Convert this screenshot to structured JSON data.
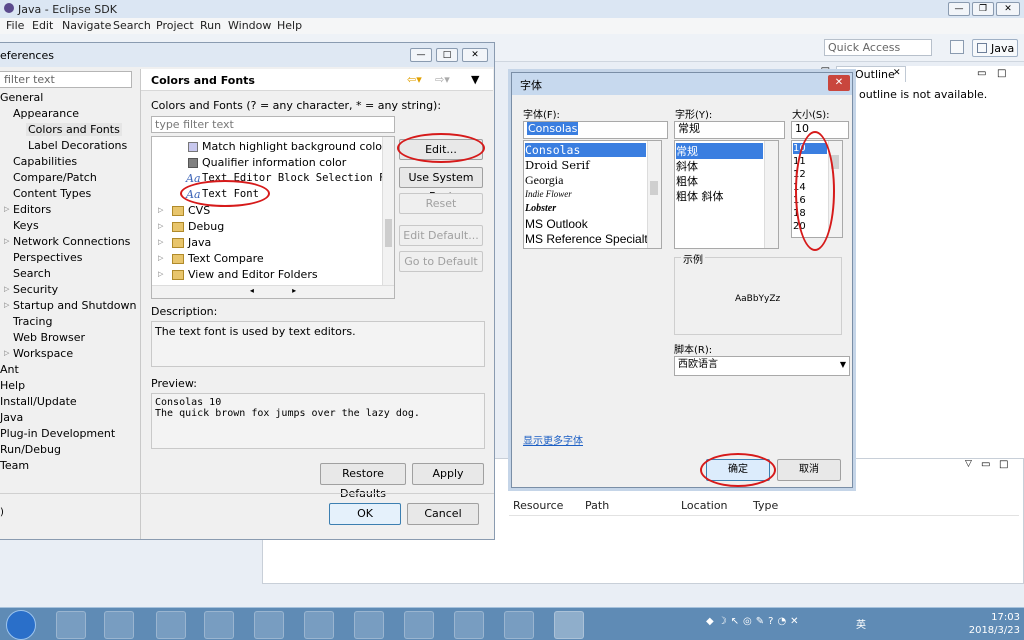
{
  "window": {
    "title": "Java - Eclipse SDK"
  },
  "menu": [
    "File",
    "Edit",
    "Navigate",
    "Search",
    "Project",
    "Run",
    "Window",
    "Help"
  ],
  "toolbar": {
    "quick_access": "Quick Access",
    "perspective": "Java"
  },
  "outline": {
    "tab": "Outline",
    "message": "outline is not available."
  },
  "problems_table": {
    "columns": [
      "Resource",
      "Path",
      "Location",
      "Type"
    ]
  },
  "prefs": {
    "title": "eferences",
    "filter_placeholder": "filter text",
    "tree": [
      "General",
      "Appearance",
      "Colors and Fonts",
      "Label Decorations",
      "Capabilities",
      "Compare/Patch",
      "Content Types",
      "Editors",
      "Keys",
      "Network Connections",
      "Perspectives",
      "Search",
      "Security",
      "Startup and Shutdown",
      "Tracing",
      "Web Browser",
      "Workspace",
      "Ant",
      "Help",
      "Install/Update",
      "Java",
      "Plug-in Development",
      "Run/Debug",
      "Team"
    ],
    "page_title": "Colors and Fonts",
    "hint": "Colors and Fonts (? = any character, * = any string):",
    "cf_filter_placeholder": "type filter text",
    "cf_items": [
      "Match highlight background color",
      "Qualifier information color",
      "Text Editor Block Selection Font",
      "Text Font",
      "CVS",
      "Debug",
      "Java",
      "Text Compare",
      "View and Editor Folders"
    ],
    "buttons": {
      "edit": "Edit...",
      "use_system_font": "Use System Font",
      "reset": "Reset",
      "edit_default": "Edit Default...",
      "go_to_default": "Go to Default",
      "restore_defaults": "Restore Defaults",
      "apply": "Apply",
      "ok": "OK",
      "cancel": "Cancel"
    },
    "description_label": "Description:",
    "description": "The text font is used by text editors.",
    "preview_label": "Preview:",
    "preview_lines": [
      "Consolas 10",
      "The quick brown fox jumps over the lazy dog."
    ]
  },
  "font_dialog": {
    "title": "字体",
    "font_label": "字体(F):",
    "style_label": "字形(Y):",
    "size_label": "大小(S):",
    "font_value": "Consolas",
    "style_value": "常规",
    "size_value": "10",
    "fonts": [
      "Consolas",
      "Droid Serif",
      "Georgia",
      "Indie Flower",
      "Lobster",
      "MS Outlook",
      "MS Reference Specialt"
    ],
    "styles": [
      "常规",
      "斜体",
      "粗体",
      "粗体 斜体"
    ],
    "sizes": [
      "10",
      "11",
      "12",
      "14",
      "16",
      "18",
      "20"
    ],
    "sample_label": "示例",
    "sample_text": "AaBbYyZz",
    "script_label": "脚本(R):",
    "script_value": "西欧语言",
    "more_fonts": "显示更多字体",
    "ok": "确定",
    "cancel": "取消"
  },
  "taskbar": {
    "time": "17:03",
    "date": "2018/3/23",
    "ime": "英"
  },
  "colors": {
    "selection": "#3a7ee0",
    "annotation": "#d61a1a"
  }
}
